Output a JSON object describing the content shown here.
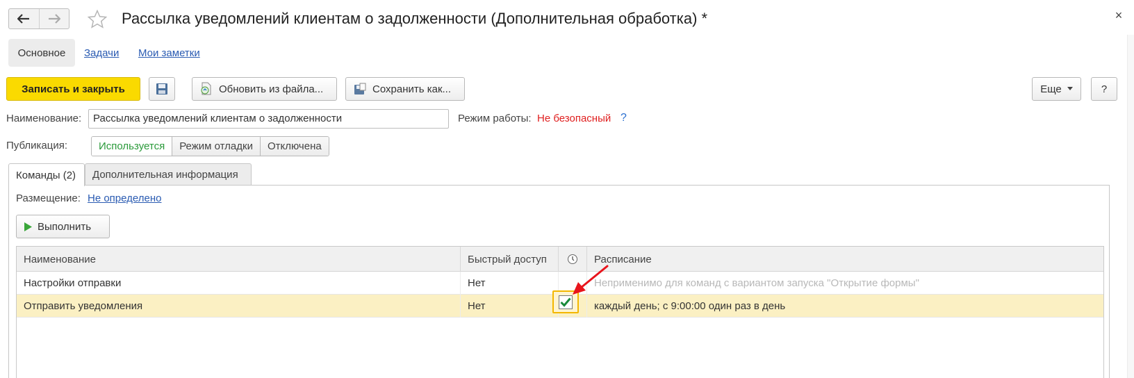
{
  "window": {
    "title": "Рассылка уведомлений клиентам о задолженности (Дополнительная обработка) *",
    "close_label": "×"
  },
  "sections": {
    "main": "Основное",
    "tasks": "Задачи",
    "notes": "Мои заметки"
  },
  "toolbar": {
    "save_close": "Записать и закрыть",
    "update_from_file": "Обновить из файла...",
    "save_as": "Сохранить как...",
    "more": "Еще",
    "help": "?"
  },
  "form": {
    "name_label": "Наименование:",
    "name_value": "Рассылка уведомлений клиентам о задолженности",
    "mode_label": "Режим работы:",
    "mode_value": "Не безопасный",
    "mode_help": "?",
    "publication_label": "Публикация:",
    "publication_options": [
      "Используется",
      "Режим отладки",
      "Отключена"
    ],
    "publication_selected": "Используется"
  },
  "tabs": {
    "commands": "Команды (2)",
    "extra": "Дополнительная информация"
  },
  "commands": {
    "placement_label": "Размещение:",
    "placement_value": "Не определено",
    "run_button": "Выполнить",
    "columns": {
      "name": "Наименование",
      "quick": "Быстрый доступ",
      "schedule": "Расписание"
    },
    "rows": [
      {
        "name": "Настройки отправки",
        "quick": "Нет",
        "scheduled": false,
        "schedule": "Неприменимо для команд с вариантом запуска \"Открытие формы\""
      },
      {
        "name": "Отправить уведомления",
        "quick": "Нет",
        "scheduled": true,
        "schedule": "каждый день; с 9:00:00 один раз в день"
      }
    ]
  },
  "colors": {
    "primary_button": "#fada00",
    "warning_text": "#e02020",
    "link": "#2a5bb2",
    "active_segment": "#2a9a3a",
    "selected_row": "#fbf0c3",
    "highlight_border": "#f3b700",
    "arrow": "#e8141c"
  }
}
